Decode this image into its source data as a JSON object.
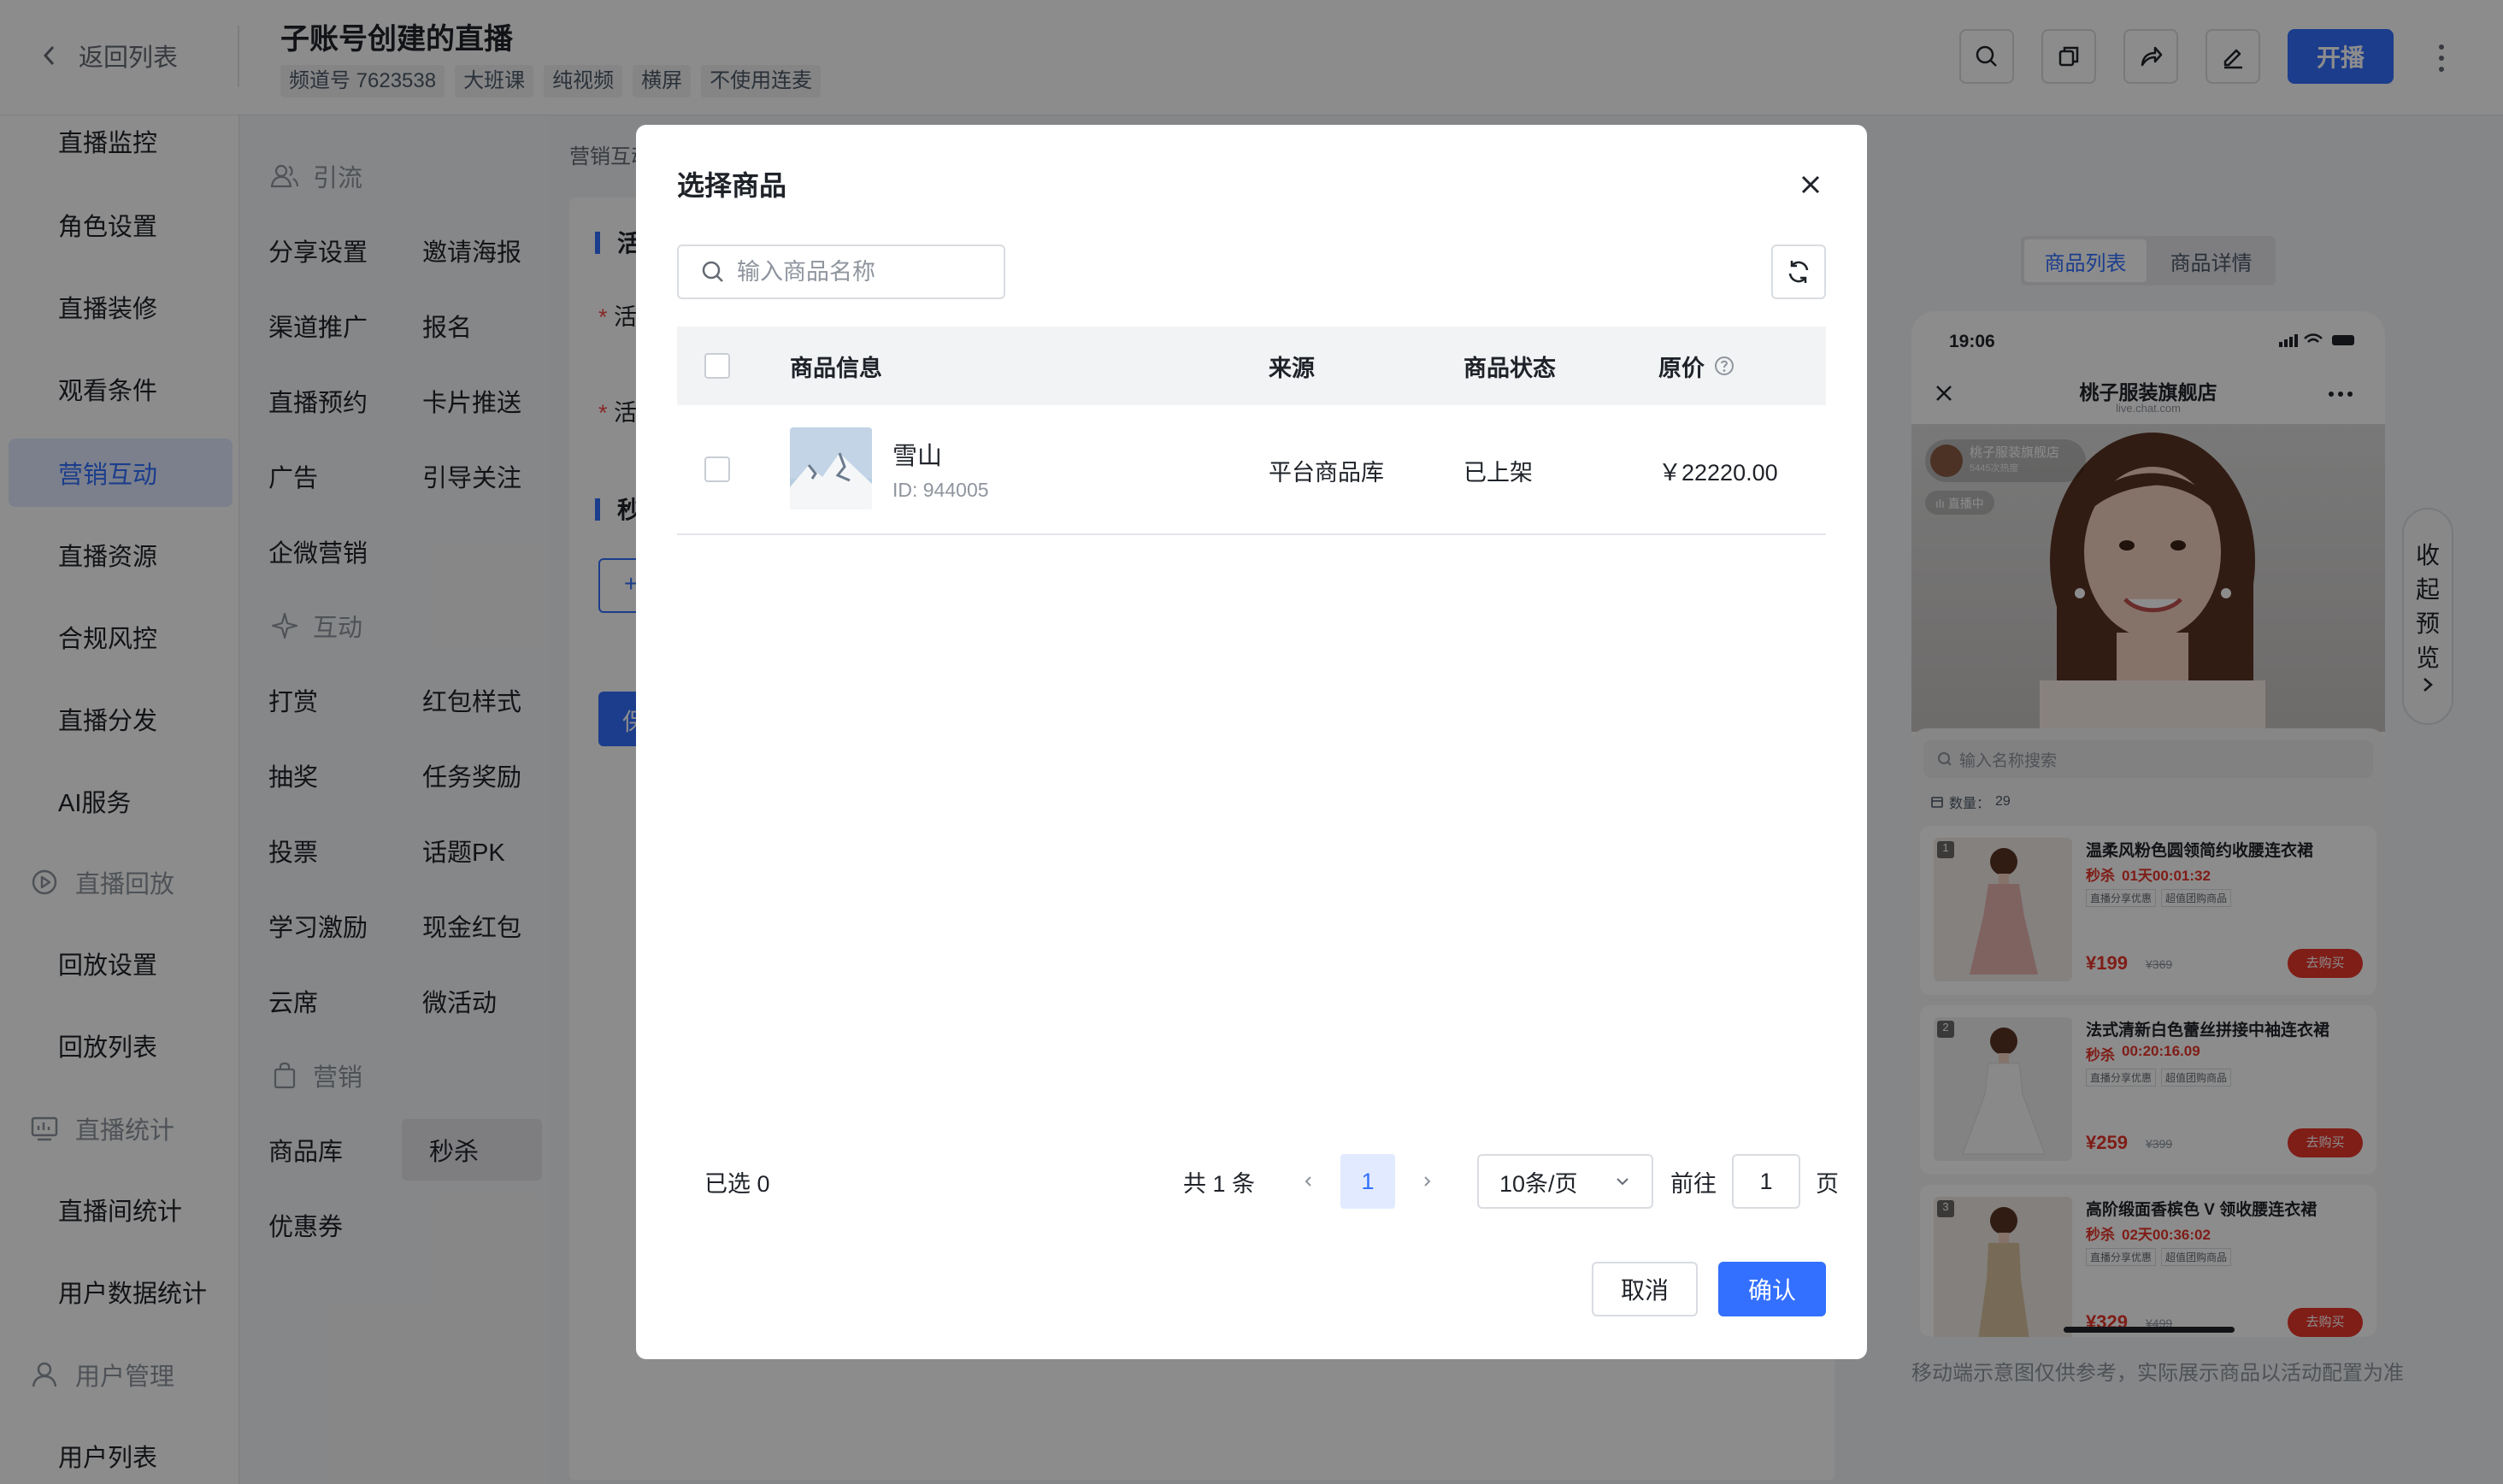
{
  "header": {
    "back_label": "返回列表",
    "title": "子账号创建的直播",
    "tags": [
      "频道号 7623538",
      "大班课",
      "纯视频",
      "横屏",
      "不使用连麦"
    ],
    "live_button": "开播"
  },
  "nav": {
    "items": [
      {
        "label": "直播监控",
        "active": false
      },
      {
        "label": "角色设置",
        "active": false
      },
      {
        "label": "直播装修",
        "active": false
      },
      {
        "label": "观看条件",
        "active": false
      },
      {
        "label": "营销互动",
        "active": true
      },
      {
        "label": "直播资源",
        "active": false
      },
      {
        "label": "合规风控",
        "active": false
      },
      {
        "label": "直播分发",
        "active": false
      },
      {
        "label": "AI服务",
        "active": false
      }
    ],
    "playback_group": "直播回放",
    "playback_items": [
      "回放设置",
      "回放列表"
    ],
    "stats_group": "直播统计",
    "stats_items": [
      "直播间统计",
      "用户数据统计"
    ],
    "user_group": "用户管理",
    "user_items": [
      "用户列表"
    ]
  },
  "subnav": {
    "group1": "引流",
    "group1_items": [
      "分享设置",
      "邀请海报",
      "渠道推广",
      "报名",
      "直播预约",
      "卡片推送",
      "广告",
      "引导关注",
      "企微营销"
    ],
    "group2": "互动",
    "group2_items": [
      "打赏",
      "红包样式",
      "抽奖",
      "任务奖励",
      "投票",
      "话题PK",
      "学习激励",
      "现金红包",
      "云席",
      "微活动"
    ],
    "group3": "营销",
    "group3_items": [
      "商品库",
      "秒杀",
      "优惠券"
    ],
    "active_item": "秒杀"
  },
  "content": {
    "breadcrumb": "营销互动",
    "section1": "活",
    "field1": "活",
    "field2": "活",
    "section2": "秒",
    "add_btn": "+",
    "save_btn": "保"
  },
  "preview": {
    "tabs": [
      "商品列表",
      "商品详情"
    ],
    "active_tab": "商品列表",
    "time": "19:06",
    "shop_name": "桃子服装旗舰店",
    "shop_url": "live.chat.com",
    "host_name": "桃子服装旗舰店",
    "host_sub": "5445次热度",
    "live_badge": "直播中",
    "search_placeholder": "输入名称搜索",
    "count_label": "数量：",
    "count": "29",
    "products": [
      {
        "index": "1",
        "name": "温柔风粉色圆领简约收腰连衣裙",
        "flash": "01天00:01:32",
        "tags": [
          "直播分享优惠",
          "超值团购商品"
        ],
        "price": "¥199",
        "orig": "¥369",
        "buy": "去购买"
      },
      {
        "index": "2",
        "name": "法式清新白色蕾丝拼接中袖连衣裙",
        "flash": "00:20:16.09",
        "tags": [
          "直播分享优惠",
          "超值团购商品"
        ],
        "price": "¥259",
        "orig": "¥399",
        "buy": "去购买"
      },
      {
        "index": "3",
        "name": "高阶缎面香槟色 V 领收腰连衣裙",
        "flash": "02天00:36:02",
        "tags": [
          "直播分享优惠",
          "超值团购商品"
        ],
        "price": "¥329",
        "orig": "¥499",
        "buy": "去购买"
      }
    ],
    "flash_tag": "秒杀",
    "collapse_label": [
      "收",
      "起",
      "预",
      "览"
    ],
    "note": "移动端示意图仅供参考，实际展示商品以活动配置为准"
  },
  "modal": {
    "title": "选择商品",
    "search_placeholder": "输入商品名称",
    "columns": [
      "商品信息",
      "来源",
      "商品状态",
      "原价"
    ],
    "rows": [
      {
        "name": "雪山",
        "id": "ID: 944005",
        "source": "平台商品库",
        "status": "已上架",
        "price": "￥22220.00"
      }
    ],
    "selected": "已选 0",
    "total": "共 1 条",
    "current_page": "1",
    "page_size": "10条/页",
    "goto_label": "前往",
    "goto_value": "1",
    "page_suffix": "页",
    "cancel": "取消",
    "confirm": "确认"
  },
  "colors": {
    "accent": "#3370ff",
    "flash_red": "#e8352b"
  }
}
